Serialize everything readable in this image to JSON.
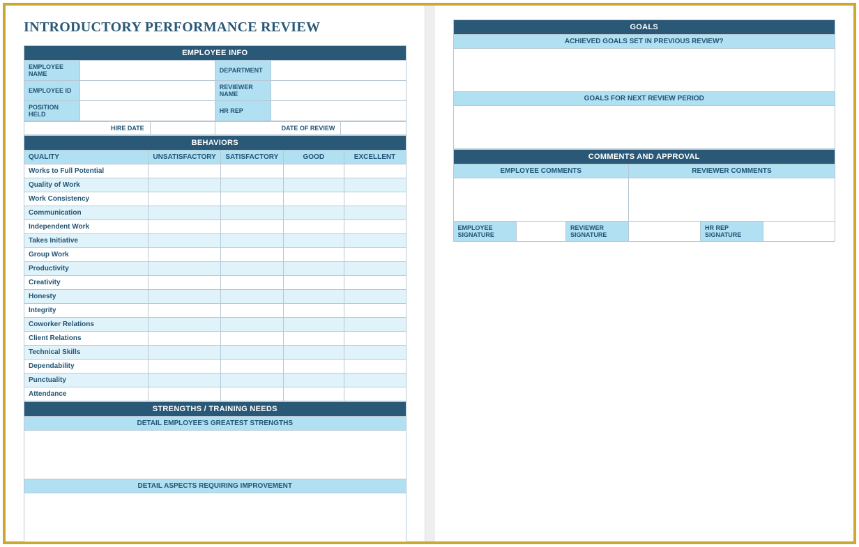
{
  "title": "INTRODUCTORY PERFORMANCE REVIEW",
  "sections": {
    "employee_info": {
      "header": "EMPLOYEE INFO",
      "fields": {
        "employee_name": "EMPLOYEE NAME",
        "department": "DEPARTMENT",
        "employee_id": "EMPLOYEE ID",
        "reviewer_name": "REVIEWER NAME",
        "position_held": "POSITION HELD",
        "hr_rep": "HR REP",
        "hire_date": "HIRE DATE",
        "date_of_review": "DATE OF REVIEW"
      }
    },
    "behaviors": {
      "header": "BEHAVIORS",
      "columns": {
        "quality": "QUALITY",
        "unsatisfactory": "UNSATISFACTORY",
        "satisfactory": "SATISFACTORY",
        "good": "GOOD",
        "excellent": "EXCELLENT"
      },
      "rows": [
        "Works to Full Potential",
        "Quality of Work",
        "Work Consistency",
        "Communication",
        "Independent Work",
        "Takes Initiative",
        "Group Work",
        "Productivity",
        "Creativity",
        "Honesty",
        "Integrity",
        "Coworker Relations",
        "Client Relations",
        "Technical Skills",
        "Dependability",
        "Punctuality",
        "Attendance"
      ]
    },
    "strengths": {
      "header": "STRENGTHS / TRAINING NEEDS",
      "sub1": "DETAIL EMPLOYEE'S GREATEST STRENGTHS",
      "sub2": "DETAIL ASPECTS REQUIRING IMPROVEMENT"
    },
    "goals": {
      "header": "GOALS",
      "sub1": "ACHIEVED GOALS SET IN PREVIOUS REVIEW?",
      "sub2": "GOALS FOR NEXT REVIEW PERIOD"
    },
    "comments": {
      "header": "COMMENTS AND APPROVAL",
      "employee_comments": "EMPLOYEE COMMENTS",
      "reviewer_comments": "REVIEWER COMMENTS",
      "employee_signature": "EMPLOYEE SIGNATURE",
      "reviewer_signature": "REVIEWER SIGNATURE",
      "hr_rep_signature": "HR REP SIGNATURE"
    }
  }
}
